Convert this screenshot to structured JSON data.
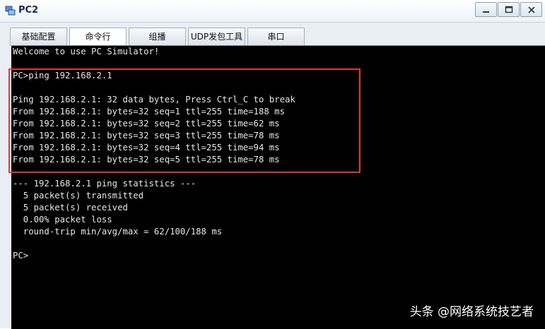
{
  "window": {
    "title": "PC2",
    "buttons": {
      "minimize": "minimize",
      "maximize": "maximize",
      "close": "close"
    }
  },
  "tabs": [
    {
      "label": "基础配置",
      "active": false
    },
    {
      "label": "命令行",
      "active": true
    },
    {
      "label": "组播",
      "active": false
    },
    {
      "label": "UDP发包工具",
      "active": false
    },
    {
      "label": "串口",
      "active": false
    }
  ],
  "terminal": {
    "lines": [
      "Welcome to use PC Simulator!",
      "",
      "PC>ping 192.168.2.1",
      "",
      "Ping 192.168.2.1: 32 data bytes, Press Ctrl_C to break",
      "From 192.168.2.1: bytes=32 seq=1 ttl=255 time=188 ms",
      "From 192.168.2.1: bytes=32 seq=2 ttl=255 time=62 ms",
      "From 192.168.2.1: bytes=32 seq=3 ttl=255 time=78 ms",
      "From 192.168.2.1: bytes=32 seq=4 ttl=255 time=94 ms",
      "From 192.168.2.1: bytes=32 seq=5 ttl=255 time=78 ms",
      "",
      "--- 192.168.2.1 ping statistics ---",
      "  5 packet(s) transmitted",
      "  5 packet(s) received",
      "  0.00% packet loss",
      "  round-trip min/avg/max = 62/100/188 ms",
      "",
      "PC>"
    ],
    "highlight_color": "#e03a3a"
  },
  "watermark": "头条 @网络系统技艺者"
}
